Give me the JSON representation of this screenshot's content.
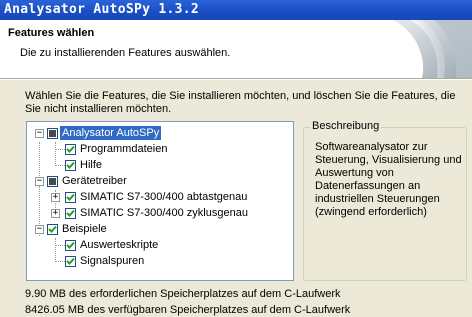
{
  "window": {
    "title": "Analysator AutoSPy 1.3.2"
  },
  "header": {
    "title": "Features wählen",
    "subtitle": "Die zu installierenden Features auswählen."
  },
  "intro": "Wählen Sie die Features, die Sie installieren möchten, und löschen Sie die Features, die Sie nicht installieren möchten.",
  "tree": {
    "items": [
      {
        "label": "Analysator AutoSPy",
        "checked": true,
        "partial": true,
        "expanded": true,
        "selected": true
      },
      {
        "label": "Programmdateien",
        "checked": true
      },
      {
        "label": "Hilfe",
        "checked": true
      },
      {
        "label": "Gerätetreiber",
        "checked": true,
        "partial": true,
        "expanded": true
      },
      {
        "label": "SIMATIC S7-300/400 abtastgenau",
        "checked": true,
        "expanded": false
      },
      {
        "label": "SIMATIC S7-300/400 zyklusgenau",
        "checked": true,
        "expanded": false
      },
      {
        "label": "Beispiele",
        "checked": true,
        "expanded": true
      },
      {
        "label": "Auswerteskripte",
        "checked": true
      },
      {
        "label": "Signalspuren",
        "checked": true
      }
    ]
  },
  "description": {
    "legend": "Beschreibung",
    "text": "Softwareanalysator zur Steuerung, Visualisierung und Auswertung von Datenerfassungen an industriellen Steuerungen (zwingend erforderlich)"
  },
  "disk": {
    "required": "9.90 MB des erforderlichen Speicherplatzes auf dem C-Laufwerk",
    "available": "8426.05 MB des verfügbaren Speicherplatzes auf dem C-Laufwerk"
  },
  "colors": {
    "title_bar": "#1a4fc4",
    "selection": "#316ac5",
    "dialog_bg": "#ece9d8"
  }
}
